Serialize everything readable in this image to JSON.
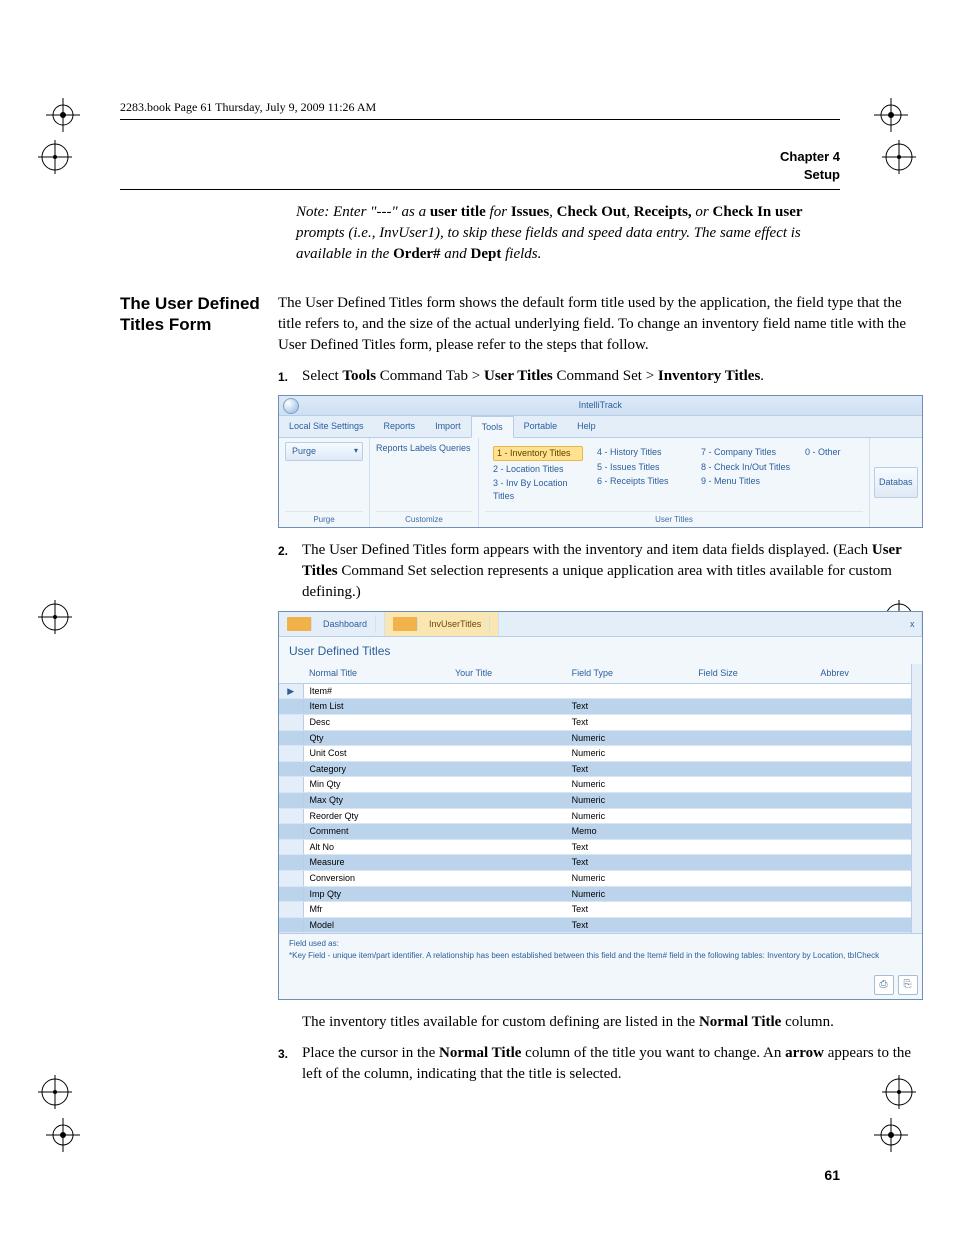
{
  "header": {
    "running": "2283.book  Page 61  Thursday, July 9, 2009  11:26 AM",
    "chapter_line1": "Chapter 4",
    "chapter_line2": "Setup"
  },
  "note": {
    "prefix": "Note:  Enter \"---\" as a ",
    "bold1": "user title",
    "mid1": " for ",
    "bold2": "Issues",
    "mid2": ", ",
    "bold3": "Check Out",
    "mid3": ", ",
    "bold4": "Receipts,",
    "mid4": " or ",
    "bold5": "Check In user",
    "tail1": " prompts (i.e., InvUser1), to skip these fields and speed data entry. The same effect is available in the ",
    "bold6": "Order#",
    "mid5": " and ",
    "bold7": "Dept",
    "tail2": " fields."
  },
  "sidehead": "The User Defined Titles Form",
  "intro": "The User Defined Titles form shows the default form title used by the application, the field type that the title refers to, and the size of the actual underlying field. To change an inventory field name title with the User Defined Titles form, please refer to the steps that follow.",
  "steps": {
    "s1": {
      "num": "1.",
      "pre": "Select ",
      "b1": "Tools",
      "m1": " Command Tab > ",
      "b2": "User Titles",
      "m2": " Command Set > ",
      "b3": "Inventory Titles",
      "post": "."
    },
    "s2": {
      "num": "2.",
      "pre": "The User Defined Titles form appears with the inventory and item data fields displayed. (Each ",
      "b1": "User Titles",
      "post": " Command Set selection represents a unique application area with titles available for custom defining.)"
    },
    "s2b": {
      "pre": "The inventory titles available for custom defining are listed in the ",
      "b1": "Normal Title",
      "post": " column."
    },
    "s3": {
      "num": "3.",
      "pre": "Place the cursor in the ",
      "b1": "Normal Title",
      "m1": " column of the title you want to change. An ",
      "b2": "arrow",
      "post": " appears to the left of the column, indicating that the title is selected."
    }
  },
  "shot1": {
    "title": "IntelliTrack",
    "tabs": [
      "Local Site Settings",
      "Reports",
      "Import",
      "Tools",
      "Portable",
      "Help"
    ],
    "activeTab": "Tools",
    "purge": "Purge",
    "grp_purge": "Purge",
    "grp_custom": "Customize",
    "grp_usertitles": "User Titles",
    "reports_labels_queries": "Reports Labels Queries",
    "col1": [
      "1 - Inventory Titles",
      "2 - Location Titles",
      "3 - Inv By Location Titles"
    ],
    "col2": [
      "4 - History Titles",
      "5 - Issues Titles",
      "6 - Receipts Titles"
    ],
    "col3": [
      "7 - Company Titles",
      "8 - Check In/Out Titles",
      "9 - Menu Titles"
    ],
    "col4": [
      "0 - Other"
    ],
    "rightbtn": "Databas"
  },
  "shot2": {
    "tab_dash": "Dashboard",
    "tab_active": "InvUserTitles",
    "close": "x",
    "formtitle": "User Defined Titles",
    "headers": [
      "",
      "Normal Title",
      "Your Title",
      "Field Type",
      "Field Size",
      "Abbrev"
    ],
    "rows": [
      {
        "rowhdr": "▶",
        "c1": "Item#",
        "c2": "",
        "c3": "",
        "c4": "",
        "c5": "",
        "hl": false
      },
      {
        "rowhdr": "",
        "c1": "Item List",
        "c2": "",
        "c3": "Text",
        "c4": "",
        "c5": "",
        "hl": true
      },
      {
        "rowhdr": "",
        "c1": "Desc",
        "c2": "",
        "c3": "Text",
        "c4": "",
        "c5": "",
        "hl": false
      },
      {
        "rowhdr": "",
        "c1": "Qty",
        "c2": "",
        "c3": "Numeric",
        "c4": "",
        "c5": "",
        "hl": true
      },
      {
        "rowhdr": "",
        "c1": "Unit Cost",
        "c2": "",
        "c3": "Numeric",
        "c4": "",
        "c5": "",
        "hl": false
      },
      {
        "rowhdr": "",
        "c1": "Category",
        "c2": "",
        "c3": "Text",
        "c4": "",
        "c5": "",
        "hl": true
      },
      {
        "rowhdr": "",
        "c1": "Min Qty",
        "c2": "",
        "c3": "Numeric",
        "c4": "",
        "c5": "",
        "hl": false
      },
      {
        "rowhdr": "",
        "c1": "Max Qty",
        "c2": "",
        "c3": "Numeric",
        "c4": "",
        "c5": "",
        "hl": true
      },
      {
        "rowhdr": "",
        "c1": "Reorder Qty",
        "c2": "",
        "c3": "Numeric",
        "c4": "",
        "c5": "",
        "hl": false
      },
      {
        "rowhdr": "",
        "c1": "Comment",
        "c2": "",
        "c3": "Memo",
        "c4": "",
        "c5": "",
        "hl": true
      },
      {
        "rowhdr": "",
        "c1": "Alt No",
        "c2": "",
        "c3": "Text",
        "c4": "",
        "c5": "",
        "hl": false
      },
      {
        "rowhdr": "",
        "c1": "Measure",
        "c2": "",
        "c3": "Text",
        "c4": "",
        "c5": "",
        "hl": true
      },
      {
        "rowhdr": "",
        "c1": "Conversion",
        "c2": "",
        "c3": "Numeric",
        "c4": "",
        "c5": "",
        "hl": false
      },
      {
        "rowhdr": "",
        "c1": "Imp Qty",
        "c2": "",
        "c3": "Numeric",
        "c4": "",
        "c5": "",
        "hl": true
      },
      {
        "rowhdr": "",
        "c1": "Mfr",
        "c2": "",
        "c3": "Text",
        "c4": "",
        "c5": "",
        "hl": false
      },
      {
        "rowhdr": "",
        "c1": "Model",
        "c2": "",
        "c3": "Text",
        "c4": "",
        "c5": "",
        "hl": true
      }
    ],
    "foot_label": "Field used as:",
    "foot_text": "*Key Field - unique item/part identifier.  A relationship has been established between this field and the Item# field in the following tables:  Inventory by Location, tbICheck",
    "btn_print": "⎙",
    "btn_exit": "⎘"
  },
  "pagenum": "61"
}
